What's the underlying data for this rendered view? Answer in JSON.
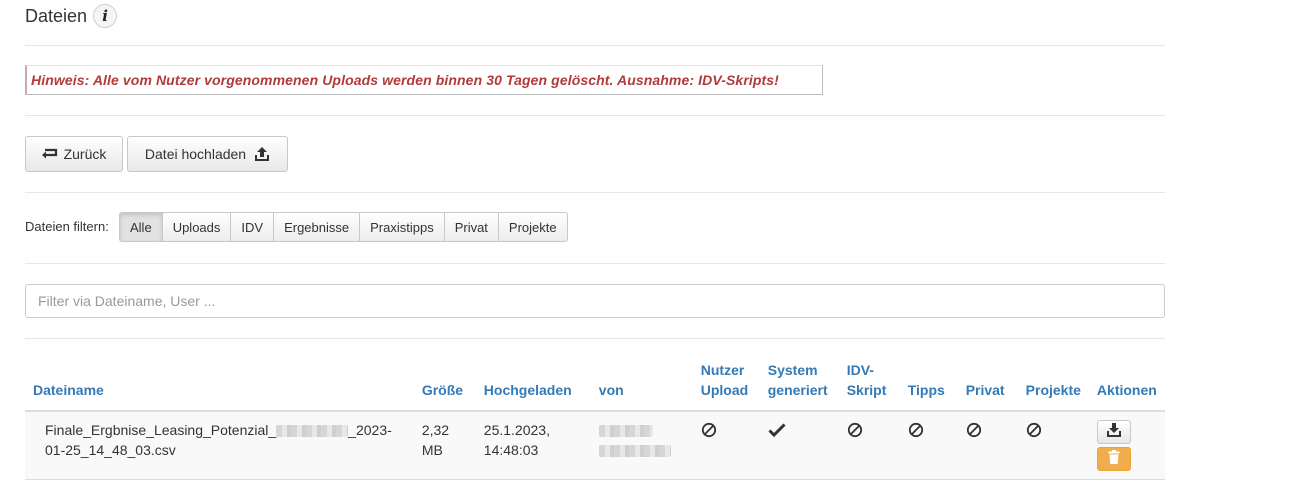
{
  "header": {
    "title": "Dateien",
    "info_icon": "info-icon"
  },
  "notice": "Hinweis: Alle vom Nutzer vorgenommenen Uploads werden binnen 30 Tagen gelöscht. Ausnahme: IDV-Skripts!",
  "toolbar": {
    "back_label": "Zurück",
    "upload_label": "Datei hochladen"
  },
  "filters": {
    "label": "Dateien filtern:",
    "options": [
      "Alle",
      "Uploads",
      "IDV",
      "Ergebnisse",
      "Praxistipps",
      "Privat",
      "Projekte"
    ],
    "active": "Alle"
  },
  "search": {
    "placeholder": "Filter via Dateiname, User ..."
  },
  "table": {
    "columns": [
      "Dateiname",
      "Größe",
      "Hochgeladen",
      "von",
      "Nutzer Upload",
      "System generiert",
      "IDV-Skript",
      "Tipps",
      "Privat",
      "Projekte",
      "Aktionen"
    ],
    "rows": [
      {
        "filename_start": "Finale_Ergbnise_Leasing_Potenzial_",
        "filename_end": "_2023-01-25_14_48_03.csv",
        "size": "2,32 MB",
        "uploaded": "25.1.2023, 14:48:03",
        "nutzer_upload": "no",
        "system_generiert": "yes",
        "idv_skript": "no",
        "tipps": "no",
        "privat": "no",
        "projekte": "no"
      }
    ]
  },
  "colors": {
    "link": "#337ab7",
    "notice": "#b33a3a",
    "warning": "#f0ad4e"
  }
}
